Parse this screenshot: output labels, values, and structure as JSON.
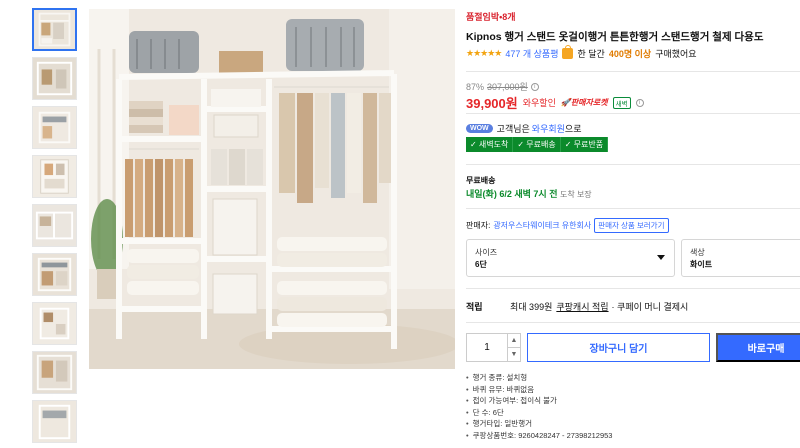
{
  "thumbnails": [
    {
      "label": "thumbnail 1"
    },
    {
      "label": "thumbnail 2"
    },
    {
      "label": "thumbnail 3"
    },
    {
      "label": "thumbnail 4"
    },
    {
      "label": "thumbnail 5"
    },
    {
      "label": "thumbnail 6"
    },
    {
      "label": "thumbnail 7"
    },
    {
      "label": "thumbnail 8"
    },
    {
      "label": "thumbnail 9"
    }
  ],
  "product": {
    "seller_tag": "품절임박•8개",
    "title": "Kipnos 행거 스탠드 옷걸이행거 튼튼한행거 스탠드행거 철제 다용도",
    "stars": "★★★★★",
    "rating_value": 5,
    "review_count": "477 개 상품평",
    "buyers_prefix": "한 달간",
    "buyers_count": "400명 이상",
    "buyers_suffix": "구매했어요"
  },
  "price": {
    "discount": "87%",
    "original": "307,000원",
    "info": "i",
    "sale": "39,900원",
    "wow_sale": "와우할인",
    "rocket_fresh": "🚀판매자로켓",
    "fresh_badge": "새벽",
    "info2": "i"
  },
  "wow": {
    "pill": "WOW",
    "text_prefix": "고객님은",
    "member": "와우회원",
    "text_suffix": "으로"
  },
  "benefits": [
    "✓ 새벽도착",
    "✓ 무료배송",
    "✓ 무료반품"
  ],
  "shipping": {
    "label": "무료배송",
    "arrival": "내일(화) 6/2 새벽 7시 전",
    "guarantee": "도착 보장"
  },
  "seller": {
    "label": "판매자:",
    "name": "광저우스타웨이테크 유한회사",
    "button": "판매자 상품 보러가기"
  },
  "options": [
    {
      "label": "사이즈",
      "value": "6단"
    },
    {
      "label": "색상",
      "value": "화이트"
    }
  ],
  "points": {
    "label": "적립",
    "prefix": "최대 399원",
    "link": "쿠팡캐시 적립",
    "suffix": "· 쿠페이 머니 결제시"
  },
  "purchase": {
    "quantity": "1",
    "up": "▲",
    "down": "▼",
    "cart": "장바구니 담기",
    "buy": "바로구매"
  },
  "specs": [
    "행거 종류: 설치형",
    "바퀴 유무: 바퀴없음",
    "접이 가능여부: 접이식 불가",
    "단 수: 6단",
    "행거타입: 일반행거",
    "쿠팡상품번호: 9260428247 - 27398212953"
  ],
  "colors": {
    "accent": "#346aff",
    "sale_red": "#e52528",
    "green": "#0b8a2b",
    "star": "#f2a30f"
  }
}
